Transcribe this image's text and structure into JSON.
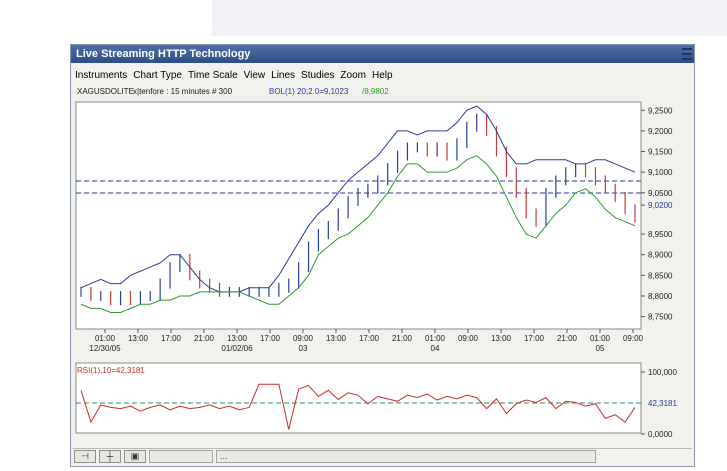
{
  "window": {
    "title": "Live Streaming HTTP Technology"
  },
  "menu": [
    "Instruments",
    "Chart Type",
    "Time Scale",
    "View",
    "Lines",
    "Studies",
    "Zoom",
    "Help"
  ],
  "info_line": {
    "instrument": "XAGUSDOLITE",
    "rest": "x|tenfore : 15 minutes # 300",
    "bol_label": "BOL(1) 20;2.0=9,1023",
    "bol_value2": "/8,9802"
  },
  "rsi": {
    "label": "RSI(1),10=42,3181",
    "value_label": "42,3181",
    "ticks": [
      "100,000",
      "0,0000"
    ]
  },
  "statusbar": {
    "field_text": "..."
  },
  "colors": {
    "upper_band": "#2a3d9a",
    "lower_band": "#2f9a2f",
    "candle": "#c43b3b",
    "rsi_line": "#cc2a2a",
    "level_line": "#2a3d9a"
  },
  "chart_data": [
    {
      "type": "line",
      "title": "",
      "price_ticks": [
        "9,2500",
        "9,2000",
        "9,1500",
        "9,1000",
        "9,0500",
        "9,0200",
        "8,9500",
        "8,9000",
        "8,8500",
        "8,8000",
        "8,7500"
      ],
      "ylim": [
        8.72,
        9.27
      ],
      "highlight_level": "9,0200",
      "x_tick_labels": [
        "01:00",
        "13:00",
        "17:00",
        "21:00",
        "13:00",
        "17:00",
        "09:00",
        "13:00",
        "17:00",
        "21:00",
        "01:00",
        "09:00",
        "13:00",
        "17:00",
        "21:00",
        "01:00",
        "09:00"
      ],
      "date_labels": [
        "12/30/05",
        "01/02/06",
        "03",
        "04",
        "05"
      ],
      "series": [
        {
          "values": [
            8.81,
            8.8,
            8.8,
            8.79,
            8.8,
            8.79,
            8.8,
            8.8,
            8.83,
            8.87,
            8.89,
            8.85,
            8.83,
            8.82,
            8.81,
            8.81,
            8.81,
            8.81,
            8.81,
            8.81,
            8.82,
            8.83,
            8.87,
            8.92,
            8.95,
            8.97,
            9.0,
            9.03,
            9.05,
            9.06,
            9.08,
            9.11,
            9.14,
            9.16,
            9.16,
            9.15,
            9.16,
            9.14,
            9.17,
            9.21,
            9.23,
            9.2,
            9.15,
            9.1,
            9.05,
            9.0,
            8.98,
            9.05,
            9.08,
            9.1,
            9.11,
            9.1,
            9.08,
            9.06,
            9.04,
            9.01,
            8.99
          ]
        },
        {
          "name": "BOL(1) 20;2.0=9,1023",
          "values": [
            8.82,
            8.83,
            8.84,
            8.83,
            8.83,
            8.85,
            8.86,
            8.87,
            8.88,
            8.9,
            8.9,
            8.87,
            8.84,
            8.82,
            8.81,
            8.81,
            8.81,
            8.82,
            8.82,
            8.82,
            8.85,
            8.89,
            8.93,
            8.97,
            9.0,
            9.02,
            9.05,
            9.08,
            9.1,
            9.12,
            9.14,
            9.17,
            9.2,
            9.2,
            9.19,
            9.2,
            9.2,
            9.2,
            9.22,
            9.25,
            9.26,
            9.24,
            9.2,
            9.15,
            9.12,
            9.12,
            9.13,
            9.13,
            9.13,
            9.13,
            9.12,
            9.12,
            9.13,
            9.13,
            9.12,
            9.11,
            9.1
          ]
        },
        {
          "name": "/8,9802",
          "values": [
            8.78,
            8.77,
            8.77,
            8.76,
            8.76,
            8.77,
            8.78,
            8.78,
            8.79,
            8.79,
            8.8,
            8.8,
            8.81,
            8.81,
            8.81,
            8.81,
            8.81,
            8.8,
            8.79,
            8.78,
            8.78,
            8.8,
            8.82,
            8.85,
            8.9,
            8.92,
            8.94,
            8.95,
            8.97,
            8.99,
            9.02,
            9.05,
            9.09,
            9.12,
            9.12,
            9.1,
            9.1,
            9.1,
            9.11,
            9.13,
            9.14,
            9.12,
            9.09,
            9.04,
            8.99,
            8.95,
            8.94,
            8.97,
            9.0,
            9.02,
            9.05,
            9.06,
            9.04,
            9.01,
            8.99,
            8.98,
            8.97
          ]
        }
      ]
    },
    {
      "type": "line",
      "title": "RSI(1),10=42,3181",
      "ylim": [
        0,
        100
      ],
      "series": [
        {
          "values": [
            70,
            18,
            46,
            42,
            40,
            44,
            36,
            42,
            46,
            38,
            44,
            40,
            42,
            46,
            40,
            44,
            38,
            42,
            80,
            80,
            80,
            6,
            72,
            78,
            60,
            70,
            55,
            66,
            62,
            48,
            60,
            56,
            52,
            62,
            58,
            64,
            54,
            60,
            56,
            62,
            58,
            40,
            56,
            32,
            48,
            54,
            50,
            58,
            40,
            52,
            50,
            44,
            48,
            24,
            30,
            18,
            42
          ]
        }
      ]
    }
  ]
}
